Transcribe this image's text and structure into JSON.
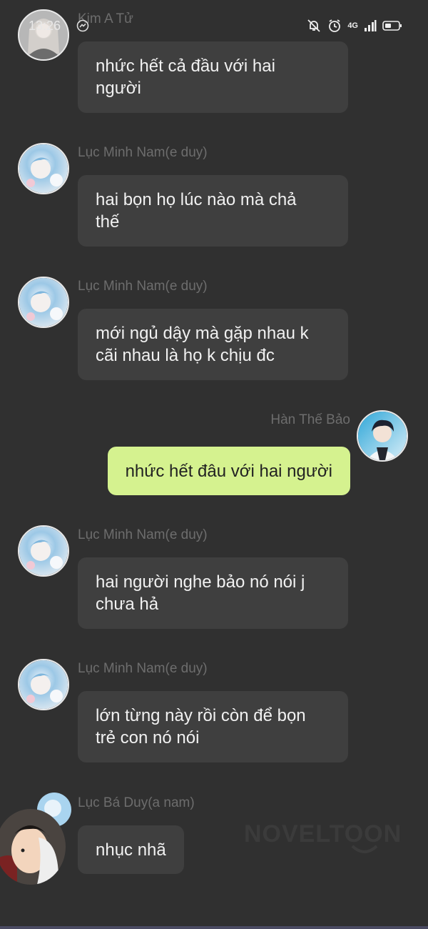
{
  "status_bar": {
    "time": "13:26",
    "network": "4G",
    "icons": [
      "messenger-icon",
      "muted-bell-icon",
      "alarm-icon",
      "signal-icon",
      "battery-icon"
    ]
  },
  "messages": [
    {
      "sender": "Kim A Tử",
      "text": "nhức hết cả đầu với hai\nngười",
      "side": "left",
      "avatar": "girl-avatar"
    },
    {
      "sender": "Lục Minh Nam(e duy)",
      "text": "hai bọn họ lúc nào mà chả\nthế",
      "side": "left",
      "avatar": "blue-hair-avatar"
    },
    {
      "sender": "Lục Minh Nam(e duy)",
      "text": "mới ngủ dậy mà gặp nhau k\ncãi nhau là họ k chịu đc",
      "side": "left",
      "avatar": "blue-hair-avatar"
    },
    {
      "sender": "Hàn Thế Bảo",
      "text": "nhức hết đâu với hai người",
      "side": "right",
      "avatar": "dark-hair-boy-avatar"
    },
    {
      "sender": "Lục Minh Nam(e duy)",
      "text": "hai người nghe bảo nó nói j\nchưa hả",
      "side": "left",
      "avatar": "blue-hair-avatar"
    },
    {
      "sender": "Lục Minh Nam(e duy)",
      "text": "lớn từng này rồi còn để bọn\ntrẻ con nó nói",
      "side": "left",
      "avatar": "blue-hair-avatar"
    },
    {
      "sender": "Lục Bá Duy(a nam)",
      "text": "nhục nhã",
      "side": "left",
      "avatar": "blue-avatar-with-photo-overlay"
    }
  ],
  "watermark": "NOVELTOON",
  "colors": {
    "background": "#303030",
    "bubble_other": "#3f3f3f",
    "bubble_self": "#d5f28f",
    "name_text": "#6d6d6d"
  }
}
